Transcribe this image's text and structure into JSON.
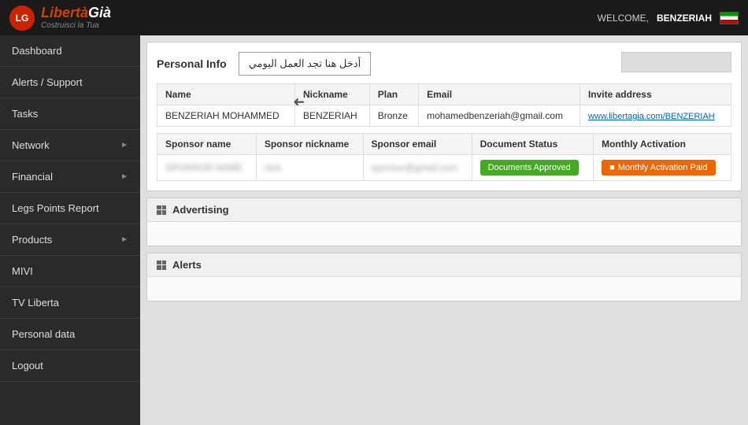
{
  "header": {
    "logo_text": "LibertàGià",
    "logo_sub": "Costruisci la Tua",
    "welcome_label": "WELCOME,",
    "username": "BENZERIAH"
  },
  "sidebar": {
    "items": [
      {
        "label": "Dashboard",
        "arrow": false
      },
      {
        "label": "Alerts / Support",
        "arrow": false
      },
      {
        "label": "Tasks",
        "arrow": false
      },
      {
        "label": "Network",
        "arrow": true
      },
      {
        "label": "Financial",
        "arrow": true
      },
      {
        "label": "Legs Points Report",
        "arrow": false
      },
      {
        "label": "Products",
        "arrow": true
      },
      {
        "label": "MIVI",
        "arrow": false
      },
      {
        "label": "TV Liberta",
        "arrow": false
      },
      {
        "label": "Personal data",
        "arrow": false
      },
      {
        "label": "Logout",
        "arrow": false
      }
    ]
  },
  "personal_info": {
    "title": "Personal Info",
    "arabic_text": "أدخل هنا تجد ا‌لعمل اليومي",
    "table1": {
      "headers": [
        "Name",
        "Nickname",
        "Plan",
        "Email",
        "Invite address"
      ],
      "rows": [
        {
          "name": "BENZERIAH MOHAMMED",
          "nickname": "BENZERIAH",
          "plan": "Bronze",
          "email": "mohamedbenzeriah@gmail.com",
          "invite": "www.libertagia.com/BENZERIAH"
        }
      ]
    },
    "table2": {
      "headers": [
        "Sponsor name",
        "Sponsor nickname",
        "Sponsor email",
        "Document Status",
        "Monthly Activation"
      ],
      "rows": [
        {
          "sponsor_name": "blurred_name",
          "sponsor_nickname": "blurred_nick",
          "sponsor_email": "blurred_email@gmail.com",
          "doc_status": "Documents Approved",
          "monthly": "Monthly Activation Paid"
        }
      ]
    }
  },
  "advertising": {
    "title": "Advertising"
  },
  "alerts": {
    "title": "Alerts"
  }
}
